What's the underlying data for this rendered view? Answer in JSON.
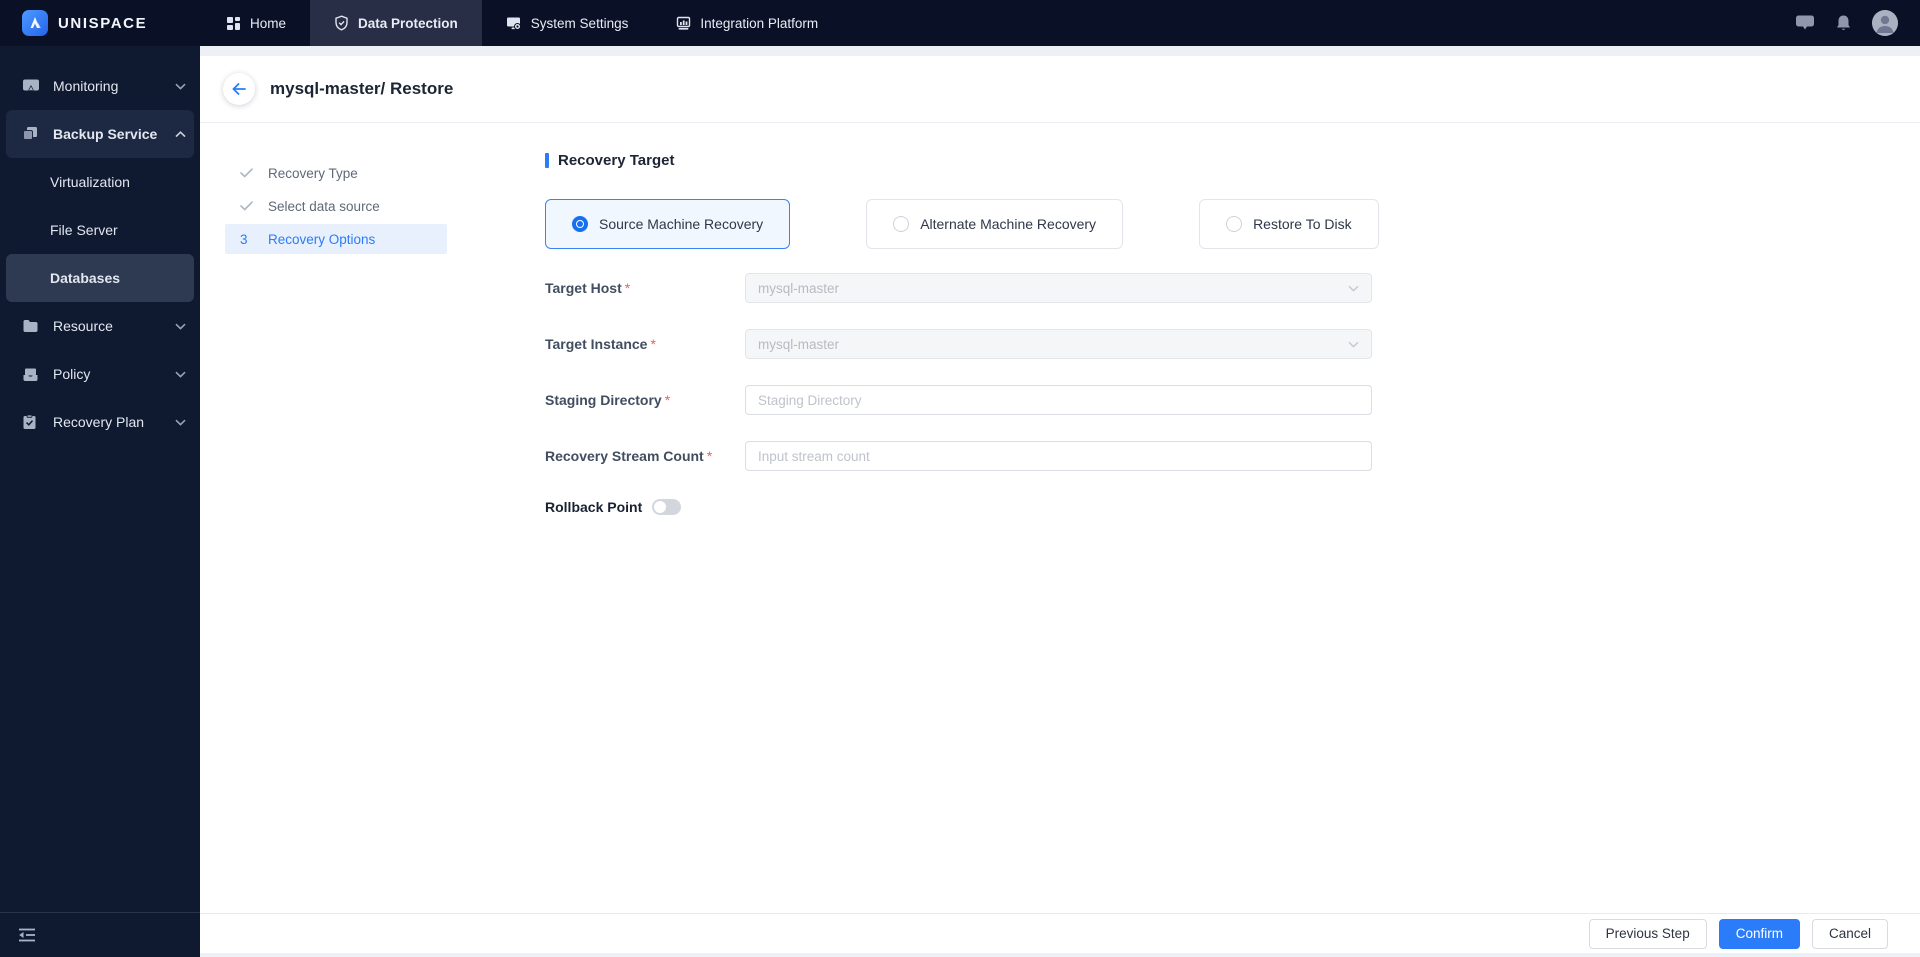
{
  "brand": {
    "name": "UNISPACE",
    "icon": "mountain-logo-icon"
  },
  "navbar": {
    "tabs": [
      {
        "label": "Home",
        "icon": "grid-icon",
        "active": false
      },
      {
        "label": "Data Protection",
        "icon": "shield-check-icon",
        "active": true
      },
      {
        "label": "System Settings",
        "icon": "monitor-gear-icon",
        "active": false
      },
      {
        "label": "Integration Platform",
        "icon": "bar-chart-icon",
        "active": false
      }
    ],
    "right_icons": [
      "message-icon",
      "bell-icon",
      "user-avatar"
    ]
  },
  "sidebar": {
    "items": [
      {
        "label": "Monitoring",
        "icon": "screen-share-icon",
        "state": "collapsed"
      },
      {
        "label": "Backup Service",
        "icon": "copy-icon",
        "state": "expanded"
      },
      {
        "label": "Virtualization",
        "type": "sub-item"
      },
      {
        "label": "File Server",
        "type": "sub-item"
      },
      {
        "label": "Databases",
        "type": "sub-item",
        "selected": true
      },
      {
        "label": "Resource",
        "icon": "folder-icon",
        "state": "collapsed"
      },
      {
        "label": "Policy",
        "icon": "archive-icon",
        "state": "collapsed"
      },
      {
        "label": "Recovery Plan",
        "icon": "clipboard-check-icon",
        "state": "collapsed"
      }
    ]
  },
  "header": {
    "title": "mysql-master/ Restore"
  },
  "steps": [
    {
      "label": "Recovery Type",
      "state": "done"
    },
    {
      "label": "Select data source",
      "state": "done"
    },
    {
      "number": "3",
      "label": "Recovery Options",
      "state": "current"
    }
  ],
  "section": {
    "title": "Recovery Target"
  },
  "options": [
    {
      "label": "Source Machine Recovery",
      "selected": true
    },
    {
      "label": "Alternate Machine Recovery",
      "selected": false
    },
    {
      "label": "Restore To Disk",
      "selected": false
    }
  ],
  "fields": {
    "target_host": {
      "label": "Target Host",
      "required": "*",
      "value": "mysql-master",
      "disabled": true
    },
    "target_instance": {
      "label": "Target Instance",
      "required": "*",
      "value": "mysql-master",
      "disabled": true
    },
    "staging_directory": {
      "label": "Staging Directory",
      "required": "*",
      "placeholder": "Staging Directory"
    },
    "stream_count": {
      "label": "Recovery Stream Count",
      "required": "*",
      "placeholder": "Input stream count"
    },
    "rollback_point": {
      "label": "Rollback Point",
      "enabled": false
    }
  },
  "footer": {
    "previous": "Previous Step",
    "confirm": "Confirm",
    "cancel": "Cancel"
  },
  "colors": {
    "accent": "#2b7cf8",
    "navbar_bg": "#0a1126",
    "sidebar_bg": "#0f1930",
    "active_tab_bg": "#272e45",
    "selected_row_bg": "#2e3952",
    "step_highlight_bg": "#e7f0fc",
    "selected_card_bg": "#f0f7ff",
    "required_mark": "#f45b5b",
    "disabled_input_bg": "#f5f6f8"
  }
}
